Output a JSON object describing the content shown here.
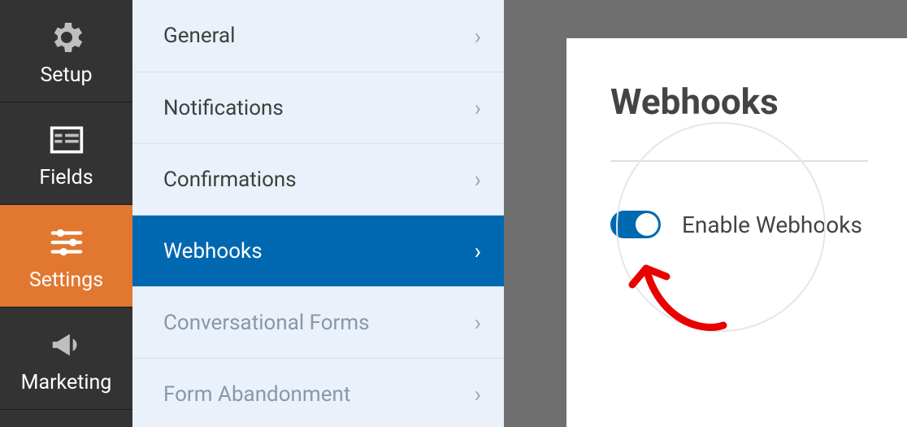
{
  "sidebar": {
    "items": [
      {
        "label": "Setup"
      },
      {
        "label": "Fields"
      },
      {
        "label": "Settings"
      },
      {
        "label": "Marketing"
      }
    ],
    "active_index": 2
  },
  "submenu": {
    "items": [
      {
        "label": "General"
      },
      {
        "label": "Notifications"
      },
      {
        "label": "Confirmations"
      },
      {
        "label": "Webhooks"
      },
      {
        "label": "Conversational Forms"
      },
      {
        "label": "Form Abandonment"
      }
    ],
    "selected_index": 3
  },
  "panel": {
    "title": "Webhooks",
    "toggle_label": "Enable Webhooks",
    "toggle_on": true
  },
  "colors": {
    "accent_orange": "#e27730",
    "accent_blue": "#0068b1",
    "annotation_red": "#e90000"
  }
}
